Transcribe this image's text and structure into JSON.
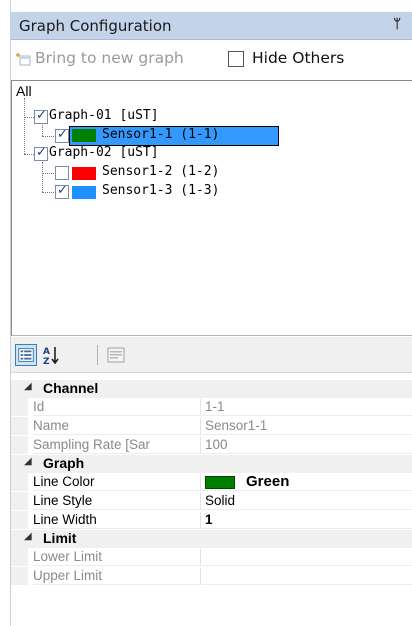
{
  "panel": {
    "title": "Graph Configuration",
    "pin_glyph": "ᛘ"
  },
  "toolbar": {
    "bring_label": "Bring to new graph",
    "hide_others_label": "Hide Others",
    "hide_others_checked": false
  },
  "tree": {
    "root": "All",
    "graphs": [
      {
        "label": "Graph-01 [uST]",
        "checked": true,
        "sensors": [
          {
            "label": "Sensor1-1 (1-1)",
            "checked": true,
            "color": "#008000",
            "selected": true
          }
        ]
      },
      {
        "label": "Graph-02 [uST]",
        "checked": true,
        "sensors": [
          {
            "label": "Sensor1-2 (1-2)",
            "checked": false,
            "color": "#ff0000",
            "selected": false
          },
          {
            "label": "Sensor1-3 (1-3)",
            "checked": true,
            "color": "#1e90ff",
            "selected": false
          }
        ]
      }
    ]
  },
  "properties": {
    "categories": [
      {
        "name": "Channel",
        "rows": [
          {
            "name": "Id",
            "value": "1-1",
            "readonly": true
          },
          {
            "name": "Name",
            "value": "Sensor1-1",
            "readonly": true
          },
          {
            "name": "Sampling Rate [Sar",
            "value": "100",
            "readonly": true
          }
        ]
      },
      {
        "name": "Graph",
        "rows": [
          {
            "name": "Line Color",
            "value": "Green",
            "readonly": false,
            "color": "#008000"
          },
          {
            "name": "Line Style",
            "value": "Solid",
            "readonly": false
          },
          {
            "name": "Line Width",
            "value": "1",
            "readonly": false
          }
        ]
      },
      {
        "name": "Limit",
        "rows": [
          {
            "name": "Lower Limit",
            "value": "",
            "readonly": true
          },
          {
            "name": "Upper Limit",
            "value": "",
            "readonly": true
          }
        ]
      }
    ]
  }
}
